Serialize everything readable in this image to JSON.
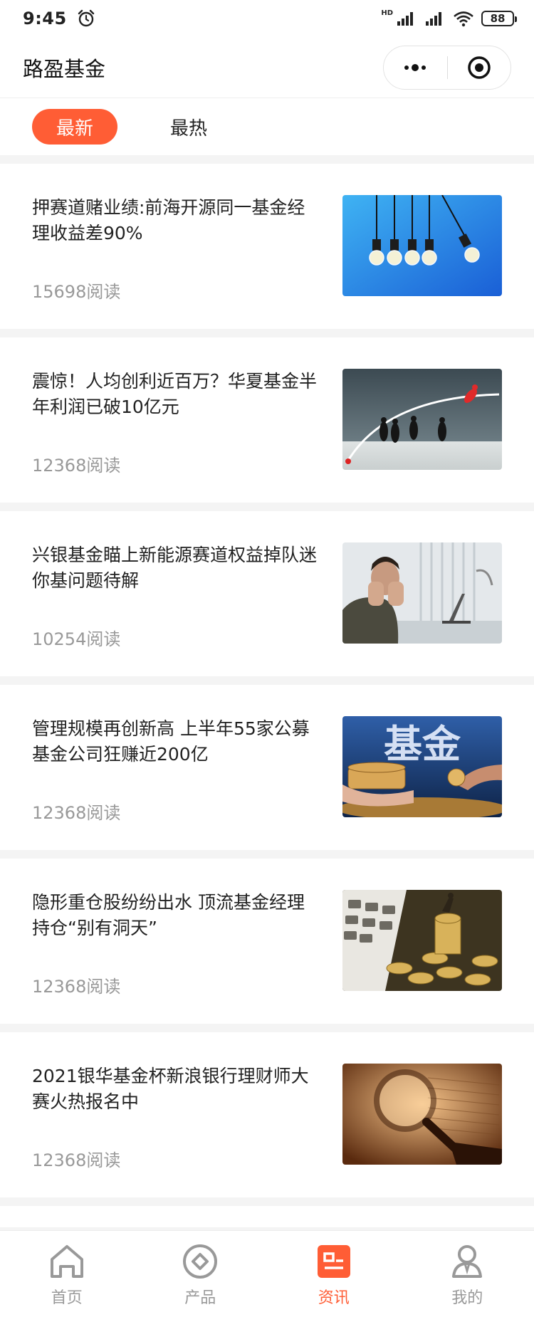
{
  "status_bar": {
    "time": "9:45",
    "network": "HD",
    "battery": "88"
  },
  "header": {
    "title": "路盈基金"
  },
  "tabs": [
    {
      "label": "最新",
      "active": true
    },
    {
      "label": "最热",
      "active": false
    }
  ],
  "articles": [
    {
      "title": "押赛道赌业绩:前海开源同一基金经理收益差90%",
      "reads": "15698阅读",
      "thumb": "light-bulbs-image"
    },
    {
      "title": "震惊！人均创利近百万？华夏基金半年利润已破10亿元",
      "reads": "12368阅读",
      "thumb": "business-race-image"
    },
    {
      "title": "兴银基金瞄上新能源赛道权益掉队迷你基问题待解",
      "reads": "10254阅读",
      "thumb": "stressed-man-image"
    },
    {
      "title": "管理规模再创新高 上半年55家公募基金公司狂赚近200亿",
      "reads": "12368阅读",
      "thumb": "fund-coins-image"
    },
    {
      "title": "隐形重仓股纷纷出水 顶流基金经理持仓“别有洞天”",
      "reads": "12368阅读",
      "thumb": "calculator-coins-image"
    },
    {
      "title": "2021银华基金杯新浪银行理财师大赛火热报名中",
      "reads": "12368阅读",
      "thumb": "magnifier-image"
    }
  ],
  "thumb_overlay_text": "基金",
  "tabbar": [
    {
      "label": "首页",
      "icon": "home-icon",
      "active": false
    },
    {
      "label": "产品",
      "icon": "product-icon",
      "active": false
    },
    {
      "label": "资讯",
      "icon": "news-icon",
      "active": true
    },
    {
      "label": "我的",
      "icon": "profile-icon",
      "active": false
    }
  ],
  "colors": {
    "accent": "#ff5d35",
    "inactive": "#999999"
  }
}
